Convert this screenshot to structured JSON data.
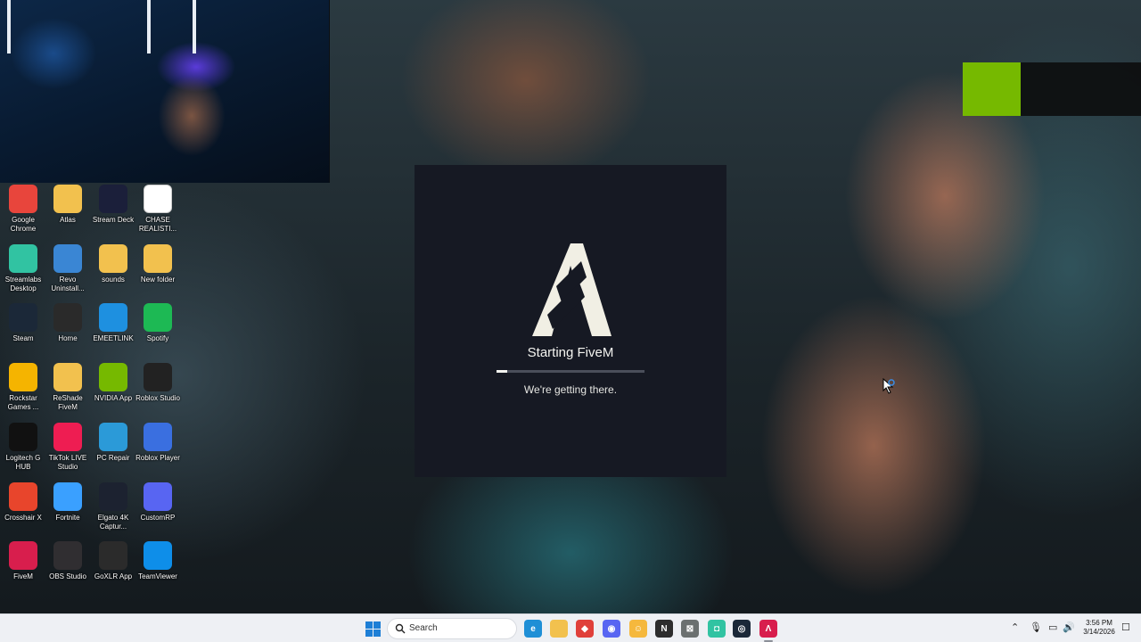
{
  "desktop": {
    "icons": [
      {
        "label": "Google Chrome",
        "icon": "chrome-icon",
        "color": "#e8453c"
      },
      {
        "label": "Atlas",
        "icon": "folder-icon",
        "color": "#f2c14e"
      },
      {
        "label": "Stream Deck",
        "icon": "stream-deck-icon",
        "color": "#1b1f3a"
      },
      {
        "label": "CHASE REALISTI...",
        "icon": "document-icon",
        "color": "#ffffff"
      },
      {
        "label": "Streamlabs Desktop",
        "icon": "streamlabs-icon",
        "color": "#31c3a2"
      },
      {
        "label": "Revo Uninstall...",
        "icon": "revo-uninstaller-icon",
        "color": "#3a86d4"
      },
      {
        "label": "sounds",
        "icon": "folder-icon",
        "color": "#f2c14e"
      },
      {
        "label": "New folder",
        "icon": "folder-icon",
        "color": "#f2c14e"
      },
      {
        "label": "Steam",
        "icon": "steam-icon",
        "color": "#1b2838"
      },
      {
        "label": "Home",
        "icon": "home-app-icon",
        "color": "#2a2a2a"
      },
      {
        "label": "EMEETLINK",
        "icon": "emeetlink-icon",
        "color": "#1e90e0"
      },
      {
        "label": "Spotify",
        "icon": "spotify-icon",
        "color": "#1db954"
      },
      {
        "label": "Rockstar Games ...",
        "icon": "rockstar-icon",
        "color": "#f5b400"
      },
      {
        "label": "ReShade FiveM",
        "icon": "folder-icon",
        "color": "#f2c14e"
      },
      {
        "label": "NVIDIA App",
        "icon": "nvidia-icon",
        "color": "#76b900"
      },
      {
        "label": "Roblox Studio",
        "icon": "roblox-studio-icon",
        "color": "#222222"
      },
      {
        "label": "Logitech G HUB",
        "icon": "logitech-icon",
        "color": "#111111"
      },
      {
        "label": "TikTok LIVE Studio",
        "icon": "tiktok-icon",
        "color": "#ee1d52"
      },
      {
        "label": "PC Repair",
        "icon": "pc-repair-icon",
        "color": "#2b9ad8"
      },
      {
        "label": "Roblox Player",
        "icon": "roblox-player-icon",
        "color": "#3a6fe0"
      },
      {
        "label": "Crosshair X",
        "icon": "crosshair-icon",
        "color": "#e8452c"
      },
      {
        "label": "Fortnite",
        "icon": "fortnite-icon",
        "color": "#3aa0ff"
      },
      {
        "label": "Elgato 4K Captur...",
        "icon": "elgato-icon",
        "color": "#1c2230"
      },
      {
        "label": "CustomRP",
        "icon": "discord-icon",
        "color": "#5865f2"
      },
      {
        "label": "FiveM",
        "icon": "fivem-icon",
        "color": "#d81e4d"
      },
      {
        "label": "OBS Studio",
        "icon": "obs-icon",
        "color": "#302e31"
      },
      {
        "label": "GoXLR App",
        "icon": "goxlr-icon",
        "color": "#2b2b2b"
      },
      {
        "label": "TeamViewer",
        "icon": "teamviewer-icon",
        "color": "#0e8ee9"
      }
    ]
  },
  "dialog": {
    "title": "Starting FiveM",
    "status": "We're getting there.",
    "progress": 0.07,
    "logo_icon": "fivem-logo-icon"
  },
  "taskbar": {
    "search_label": "Search",
    "apps": [
      {
        "name": "edge",
        "icon": "edge-icon",
        "color": "#1f8fd6",
        "glyph": "e"
      },
      {
        "name": "file-explorer",
        "icon": "folder-icon",
        "color": "#f2c14e",
        "glyph": ""
      },
      {
        "name": "app-red",
        "icon": "red-app-icon",
        "color": "#e0403a",
        "glyph": "◆"
      },
      {
        "name": "discord",
        "icon": "discord-icon",
        "color": "#5865f2",
        "glyph": "◉"
      },
      {
        "name": "emoji-app",
        "icon": "emoji-app-icon",
        "color": "#f5b83d",
        "glyph": "☺"
      },
      {
        "name": "notion",
        "icon": "notion-icon",
        "color": "#2d2d2d",
        "glyph": "N"
      },
      {
        "name": "excel",
        "icon": "excel-icon",
        "color": "#6b7070",
        "glyph": "⊠"
      },
      {
        "name": "streamlabs",
        "icon": "streamlabs-icon",
        "color": "#31c3a2",
        "glyph": "◘"
      },
      {
        "name": "steam",
        "icon": "steam-icon",
        "color": "#1b2838",
        "glyph": "◎"
      },
      {
        "name": "fivem",
        "icon": "fivem-icon",
        "color": "#d81e4d",
        "glyph": "Λ"
      }
    ],
    "time": "3:56 PM",
    "date": "3/14/2026"
  }
}
